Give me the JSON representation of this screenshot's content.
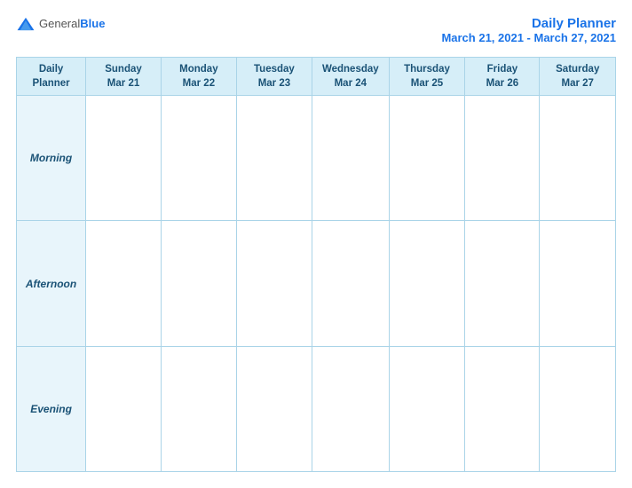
{
  "logo": {
    "general": "General",
    "blue": "Blue"
  },
  "header": {
    "title": "Daily Planner",
    "date_range": "March 21, 2021 - March 27, 2021"
  },
  "columns": [
    {
      "id": "label",
      "day": "Daily",
      "day2": "Planner",
      "date": ""
    },
    {
      "id": "sun",
      "day": "Sunday",
      "date": "Mar 21"
    },
    {
      "id": "mon",
      "day": "Monday",
      "date": "Mar 22"
    },
    {
      "id": "tue",
      "day": "Tuesday",
      "date": "Mar 23"
    },
    {
      "id": "wed",
      "day": "Wednesday",
      "date": "Mar 24"
    },
    {
      "id": "thu",
      "day": "Thursday",
      "date": "Mar 25"
    },
    {
      "id": "fri",
      "day": "Friday",
      "date": "Mar 26"
    },
    {
      "id": "sat",
      "day": "Saturday",
      "date": "Mar 27"
    }
  ],
  "rows": [
    {
      "id": "morning",
      "label": "Morning"
    },
    {
      "id": "afternoon",
      "label": "Afternoon"
    },
    {
      "id": "evening",
      "label": "Evening"
    }
  ]
}
